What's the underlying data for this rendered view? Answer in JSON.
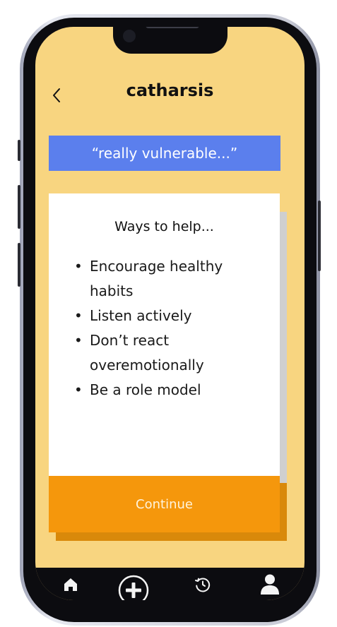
{
  "header": {
    "title": "catharsis",
    "back_icon": "chevron-left-icon"
  },
  "quote": {
    "text": "“really vulnerable...”"
  },
  "card": {
    "heading": "Ways to help...",
    "items": [
      "Encourage healthy habits",
      "Listen actively",
      "Don’t react overemotionally",
      "Be a role model"
    ]
  },
  "continue_button": {
    "label": "Continue"
  },
  "nav": {
    "items": [
      {
        "icon": "home-icon"
      },
      {
        "icon": "add-icon"
      },
      {
        "icon": "history-icon"
      },
      {
        "icon": "profile-icon"
      }
    ]
  },
  "colors": {
    "background": "#f8d580",
    "banner": "#5b7fed",
    "button": "#f5970c",
    "nav": "#0c0c10"
  }
}
